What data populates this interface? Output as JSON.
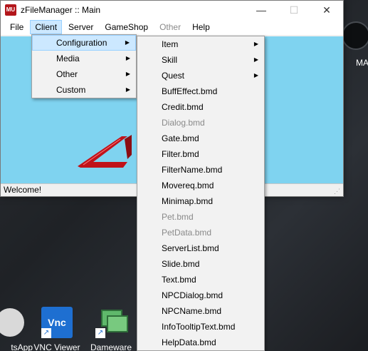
{
  "window": {
    "app_icon_text": "MU",
    "title": "zFileManager :: Main",
    "minimize": "—",
    "maximize": "☐",
    "close": "✕"
  },
  "menubar": [
    "File",
    "Client",
    "Server",
    "GameShop",
    "Other",
    "Help"
  ],
  "client_menu": [
    {
      "label": "Configuration",
      "submenu": true
    },
    {
      "label": "Media",
      "submenu": true
    },
    {
      "label": "Other",
      "submenu": true
    },
    {
      "label": "Custom",
      "submenu": true
    }
  ],
  "config_menu": [
    {
      "label": "Item",
      "submenu": true,
      "enabled": true
    },
    {
      "label": "Skill",
      "submenu": true,
      "enabled": true
    },
    {
      "label": "Quest",
      "submenu": true,
      "enabled": true
    },
    {
      "label": "BuffEffect.bmd",
      "submenu": false,
      "enabled": true
    },
    {
      "label": "Credit.bmd",
      "submenu": false,
      "enabled": true
    },
    {
      "label": "Dialog.bmd",
      "submenu": false,
      "enabled": false
    },
    {
      "label": "Gate.bmd",
      "submenu": false,
      "enabled": true
    },
    {
      "label": "Filter.bmd",
      "submenu": false,
      "enabled": true
    },
    {
      "label": "FilterName.bmd",
      "submenu": false,
      "enabled": true
    },
    {
      "label": "Movereq.bmd",
      "submenu": false,
      "enabled": true
    },
    {
      "label": "Minimap.bmd",
      "submenu": false,
      "enabled": true
    },
    {
      "label": "Pet.bmd",
      "submenu": false,
      "enabled": false
    },
    {
      "label": "PetData.bmd",
      "submenu": false,
      "enabled": false
    },
    {
      "label": "ServerList.bmd",
      "submenu": false,
      "enabled": true
    },
    {
      "label": "Slide.bmd",
      "submenu": false,
      "enabled": true
    },
    {
      "label": "Text.bmd",
      "submenu": false,
      "enabled": true
    },
    {
      "label": "NPCDialog.bmd",
      "submenu": false,
      "enabled": true
    },
    {
      "label": "NPCName.bmd",
      "submenu": false,
      "enabled": true
    },
    {
      "label": "InfoTooltipText.bmd",
      "submenu": false,
      "enabled": true
    },
    {
      "label": "HelpData.bmd",
      "submenu": false,
      "enabled": true
    }
  ],
  "status": {
    "text": "Welcome!"
  },
  "desktop": {
    "icons": [
      "tsApp",
      "VNC Viewer",
      "Dameware"
    ],
    "vnc_logo": "Vnc",
    "right_label": "MA"
  },
  "colors": {
    "accent_highlight": "#cce8ff",
    "client_bg": "#7fd3f0"
  }
}
